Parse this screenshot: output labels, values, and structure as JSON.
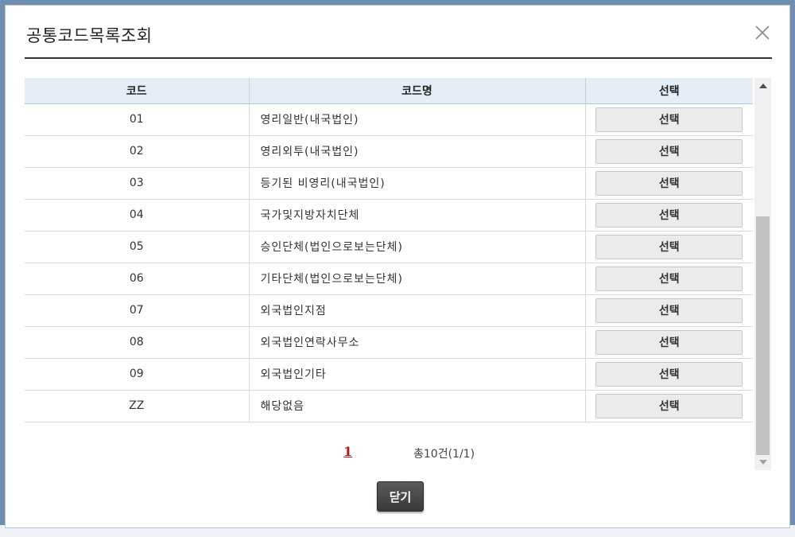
{
  "dialog": {
    "title": "공통코드목록조회",
    "close_icon": "close-icon"
  },
  "table": {
    "headers": [
      "코드",
      "코드명",
      "선택"
    ],
    "rows": [
      {
        "code": "01",
        "name": "영리일반(내국법인)",
        "select_label": "선택"
      },
      {
        "code": "02",
        "name": "영리외투(내국법인)",
        "select_label": "선택"
      },
      {
        "code": "03",
        "name": "등기된 비영리(내국법인)",
        "select_label": "선택"
      },
      {
        "code": "04",
        "name": "국가및지방자치단체",
        "select_label": "선택"
      },
      {
        "code": "05",
        "name": "승인단체(법인으로보는단체)",
        "select_label": "선택"
      },
      {
        "code": "06",
        "name": "기타단체(법인으로보는단체)",
        "select_label": "선택"
      },
      {
        "code": "07",
        "name": "외국법인지점",
        "select_label": "선택"
      },
      {
        "code": "08",
        "name": "외국법인연락사무소",
        "select_label": "선택"
      },
      {
        "code": "09",
        "name": "외국법인기타",
        "select_label": "선택"
      },
      {
        "code": "ZZ",
        "name": "해당없음",
        "select_label": "선택"
      }
    ]
  },
  "pager": {
    "current_page": "1",
    "total_text": "총10건(1/1)"
  },
  "footer": {
    "close_label": "닫기"
  },
  "colors": {
    "header_bg": "#e5edf6",
    "page_link": "#b01818",
    "close_button_bg": "#4a4a4a"
  }
}
